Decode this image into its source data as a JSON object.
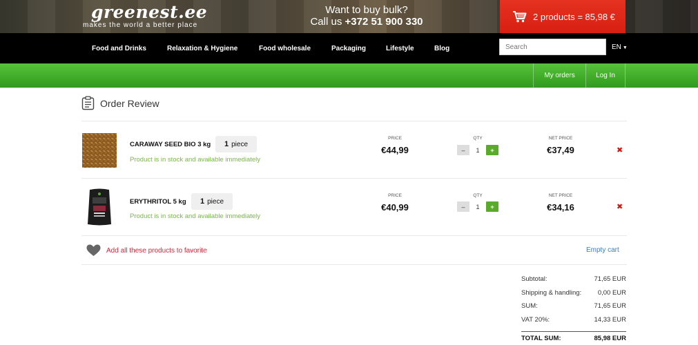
{
  "header": {
    "logo": "greenest.ee",
    "tagline": "makes the world a better place",
    "bulk_line1": "Want to buy bulk?",
    "bulk_line2_prefix": "Call us ",
    "bulk_phone": "+372 51 900 330",
    "cart_text": "2 products = 85,98 €",
    "cart_icon": "shopping-cart-icon"
  },
  "nav": {
    "items": [
      "Food and Drinks",
      "Relaxation & Hygiene",
      "Food wholesale",
      "Packaging",
      "Lifestyle",
      "Blog"
    ],
    "search_placeholder": "Search",
    "language": "EN"
  },
  "account": {
    "my_orders": "My orders",
    "log_in": "Log In"
  },
  "review": {
    "title": "Order Review",
    "icon": "clipboard-list-icon",
    "col_price": "PRICE",
    "col_qty": "QTY",
    "col_net": "NET PRICE",
    "items": [
      {
        "name": "CARAWAY SEED BIO 3 kg",
        "piece_count": "1",
        "piece_unit": "piece",
        "stock": "Product is in stock and available immediately",
        "price": "€44,99",
        "qty": "1",
        "net_price": "€37,49"
      },
      {
        "name": "ERYTHRITOL 5 kg",
        "piece_count": "1",
        "piece_unit": "piece",
        "stock": "Product is in stock and available immediately",
        "price": "€40,99",
        "qty": "1",
        "net_price": "€34,16"
      }
    ],
    "favorite_label": "Add all these products to favorite",
    "empty_cart": "Empty cart"
  },
  "totals": [
    {
      "label": "Subtotal:",
      "value": "71,65 EUR"
    },
    {
      "label": "Shipping & handling:",
      "value": "0,00 EUR"
    },
    {
      "label": "SUM:",
      "value": "71,65 EUR"
    },
    {
      "label": "VAT 20%:",
      "value": "14,33 EUR"
    },
    {
      "label": "TOTAL SUM:",
      "value": "85,98 EUR"
    }
  ],
  "colors": {
    "cart_red": "#e53221",
    "green_bar": "#3aa923",
    "stock_green": "#7ab648",
    "remove_red": "#d31414",
    "link_blue": "#3a7fc3"
  }
}
